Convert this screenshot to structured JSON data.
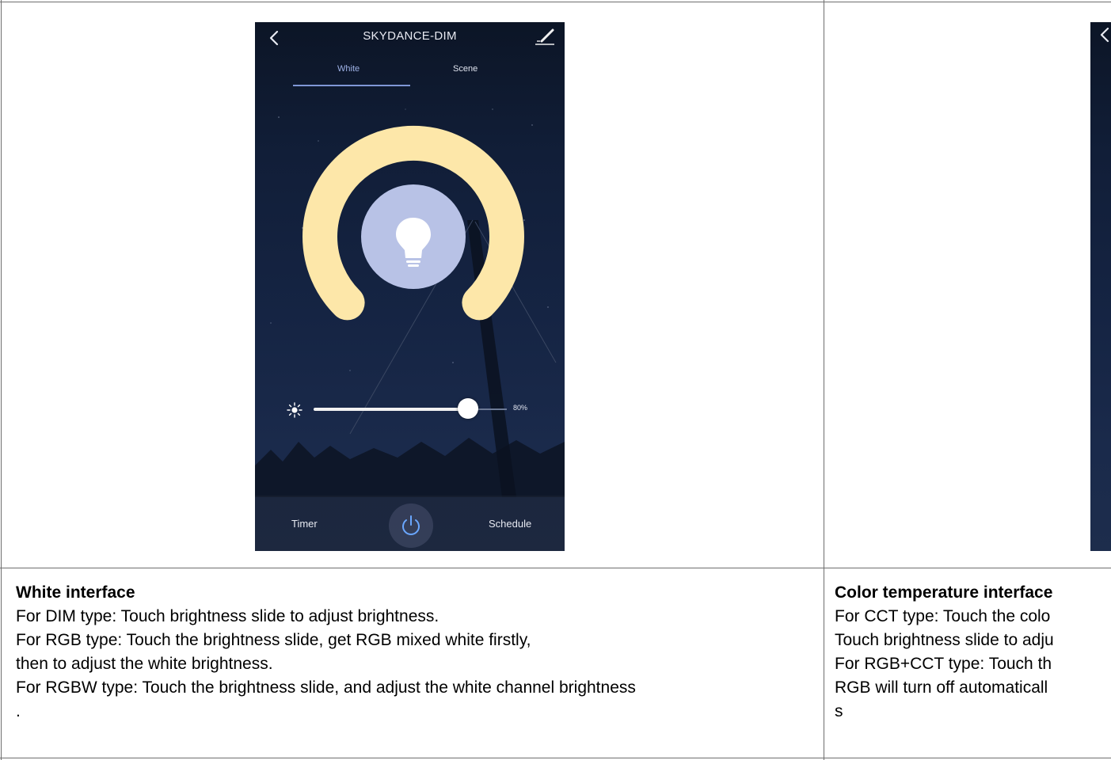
{
  "left_screen": {
    "title": "SKYDANCE-DIM",
    "tabs": [
      {
        "label": "White",
        "active": true
      },
      {
        "label": "Scene",
        "active": false
      }
    ],
    "brightness_percent": 80,
    "brightness_label": "80%",
    "timer_label": "Timer",
    "schedule_label": "Schedule",
    "icons": [
      "back-chevron-icon",
      "edit-pencil-icon",
      "bulb-icon",
      "sun-icon",
      "power-icon"
    ],
    "colors": {
      "ring": "#fde7a9",
      "bulb_circle": "#b8c2e6",
      "tab_active": "#9fb2e6"
    }
  },
  "left_cell": {
    "heading": "White interface",
    "lines": [
      "For DIM type: Touch brightness slide to adjust brightness.",
      "For RGB type: Touch the brightness slide, get RGB mixed white firstly,",
      "then to adjust the white brightness.",
      "For RGBW type: Touch the brightness slide, and adjust the white channel brightness",
      "."
    ]
  },
  "right_cell": {
    "heading": "Color temperature interface",
    "lines": [
      "For CCT type: Touch the colo",
      "Touch brightness slide to adju",
      "For RGB+CCT type: Touch th",
      "RGB will turn off automaticall",
      "s"
    ]
  }
}
